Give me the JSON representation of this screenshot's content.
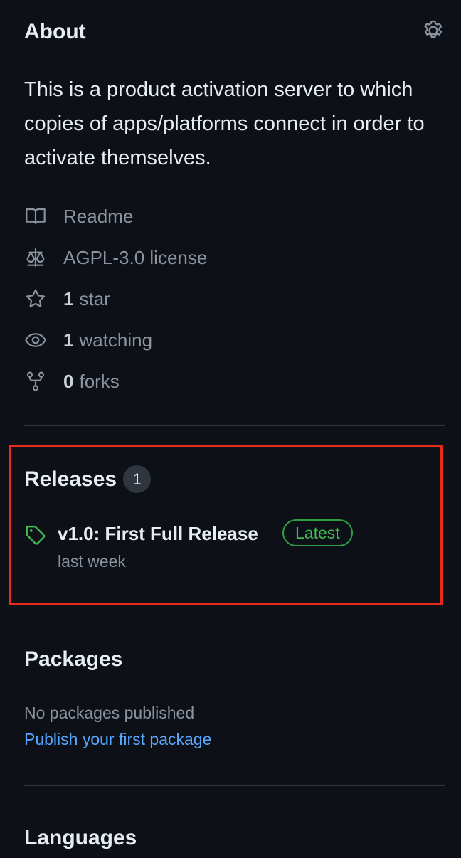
{
  "about": {
    "title": "About",
    "description": "This is a product activation server to which copies of apps/platforms connect in order to activate themselves."
  },
  "meta": [
    {
      "icon": "book-icon",
      "label": "Readme"
    },
    {
      "icon": "law-icon",
      "label": "AGPL-3.0 license"
    },
    {
      "icon": "star-icon",
      "count": "1",
      "label": "star"
    },
    {
      "icon": "eye-icon",
      "count": "1",
      "label": "watching"
    },
    {
      "icon": "repo-forked-icon",
      "count": "0",
      "label": "forks"
    }
  ],
  "releases": {
    "title": "Releases",
    "count": "1",
    "latest": {
      "name": "v1.0: First Full Release",
      "badge": "Latest",
      "date": "last week"
    }
  },
  "packages": {
    "title": "Packages",
    "empty_text": "No packages published",
    "link_text": "Publish your first package"
  },
  "languages": {
    "title": "Languages"
  },
  "colors": {
    "background": "#0d1117",
    "text_primary": "#e6edf3",
    "text_muted": "#8b949e",
    "link": "#58a6ff",
    "success": "#3fb950",
    "highlight": "#ea2a1a"
  }
}
